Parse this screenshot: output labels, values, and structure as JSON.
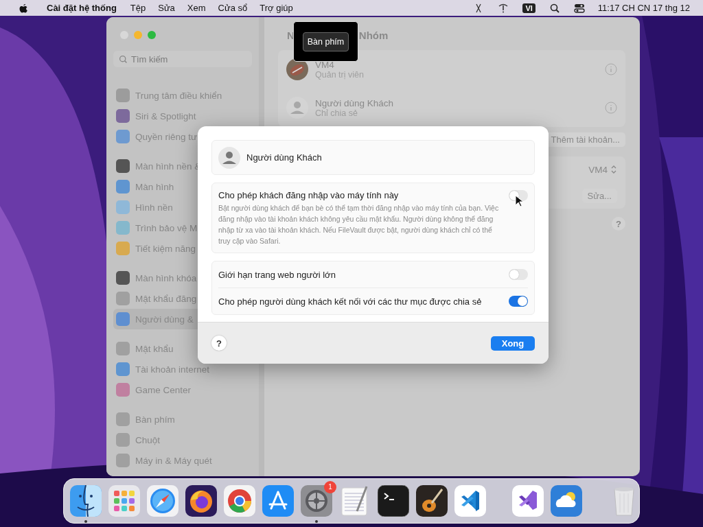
{
  "menu_bar": {
    "app_name": "Cài đặt hệ thống",
    "menus": [
      "Tệp",
      "Sửa",
      "Xem",
      "Cửa sổ",
      "Trợ giúp"
    ],
    "input_source": "VI",
    "clock": "11:17 CH CN 17 thg 12"
  },
  "window": {
    "search": {
      "placeholder": "Tìm kiếm"
    },
    "sidebar": {
      "groups": [
        [
          {
            "label": "Trung tâm điều khiển",
            "color": "#9c9c9c",
            "selected": false
          },
          {
            "label": "Siri & Spotlight",
            "color": "#7d6a9c",
            "selected": false
          },
          {
            "label": "Quyền riêng tư",
            "color": "#6e9ad0",
            "selected": false
          }
        ],
        [
          {
            "label": "Màn hình nền &",
            "color": "#555555",
            "selected": false
          },
          {
            "label": "Màn hình",
            "color": "#5f95d0",
            "selected": false
          },
          {
            "label": "Hình nền",
            "color": "#8fb8d8",
            "selected": false
          },
          {
            "label": "Trình bảo vệ M",
            "color": "#85b8cc",
            "selected": false
          },
          {
            "label": "Tiết kiệm năng",
            "color": "#d8aa50",
            "selected": false
          }
        ],
        [
          {
            "label": "Màn hình khóa",
            "color": "#555555",
            "selected": false
          },
          {
            "label": "Mật khẩu đăng",
            "color": "#a0a0a0",
            "selected": false
          },
          {
            "label": "Người dùng &",
            "color": "#5f8fd0",
            "selected": true
          }
        ],
        [
          {
            "label": "Mật khẩu",
            "color": "#a0a0a0",
            "selected": false
          },
          {
            "label": "Tài khoản internet",
            "color": "#5f95d0",
            "selected": false
          },
          {
            "label": "Game Center",
            "color": "#c080a0",
            "selected": false
          }
        ],
        [
          {
            "label": "Bàn phím",
            "color": "#a0a0a0",
            "selected": false
          },
          {
            "label": "Chuột",
            "color": "#a0a0a0",
            "selected": false
          },
          {
            "label": "Máy in & Máy quét",
            "color": "#a0a0a0",
            "selected": false
          }
        ]
      ]
    },
    "title_start": "N",
    "title_end": "Nhóm",
    "users": [
      {
        "name": "VM4",
        "role": "Quản trị viên"
      },
      {
        "name": "Người dùng Khách",
        "role": "Chỉ chia sẻ",
        "kind": "guest"
      }
    ],
    "add_account_button": "Thêm tài khoản...",
    "autologin_value": "VM4",
    "edit_button": "Sửa...",
    "help_button": "?"
  },
  "tooltip": {
    "label": "Bàn phím"
  },
  "dialog": {
    "user_name": "Người dùng Khách",
    "allow_login": {
      "title": "Cho phép khách đăng nhập vào máy tính này",
      "description": "Bật người dùng khách để bạn bè có thể tạm thời đăng nhập vào máy tính của bạn. Việc đăng nhập vào tài khoản khách không yêu cầu mật khẩu. Người dùng không thể đăng nhập từ xa vào tài khoản khách. Nếu FileVault được bật, người dùng khách chỉ có thể truy cập vào Safari.",
      "on": false
    },
    "options": [
      {
        "label": "Giới hạn trang web người lớn",
        "on": false
      },
      {
        "label": "Cho phép người dùng khách kết nối với các thư mục được chia sẻ",
        "on": true
      }
    ],
    "help_button": "?",
    "done_button": "Xong"
  },
  "dock": {
    "groups": [
      [
        {
          "kind": "finder",
          "running": true
        },
        {
          "kind": "launchpad",
          "running": false
        },
        {
          "kind": "safari",
          "running": false
        },
        {
          "kind": "firefox",
          "running": false
        },
        {
          "kind": "chrome",
          "running": false
        },
        {
          "kind": "appstore",
          "running": false
        },
        {
          "kind": "settings",
          "running": true,
          "badge": "1"
        },
        {
          "kind": "textedit",
          "running": false
        },
        {
          "kind": "terminal",
          "running": false
        },
        {
          "kind": "garageband",
          "running": false
        },
        {
          "kind": "vscode",
          "running": false
        }
      ],
      [
        {
          "kind": "visualstudio",
          "running": false
        },
        {
          "kind": "weather",
          "running": false
        }
      ],
      [
        {
          "kind": "trash",
          "running": false
        }
      ]
    ]
  }
}
